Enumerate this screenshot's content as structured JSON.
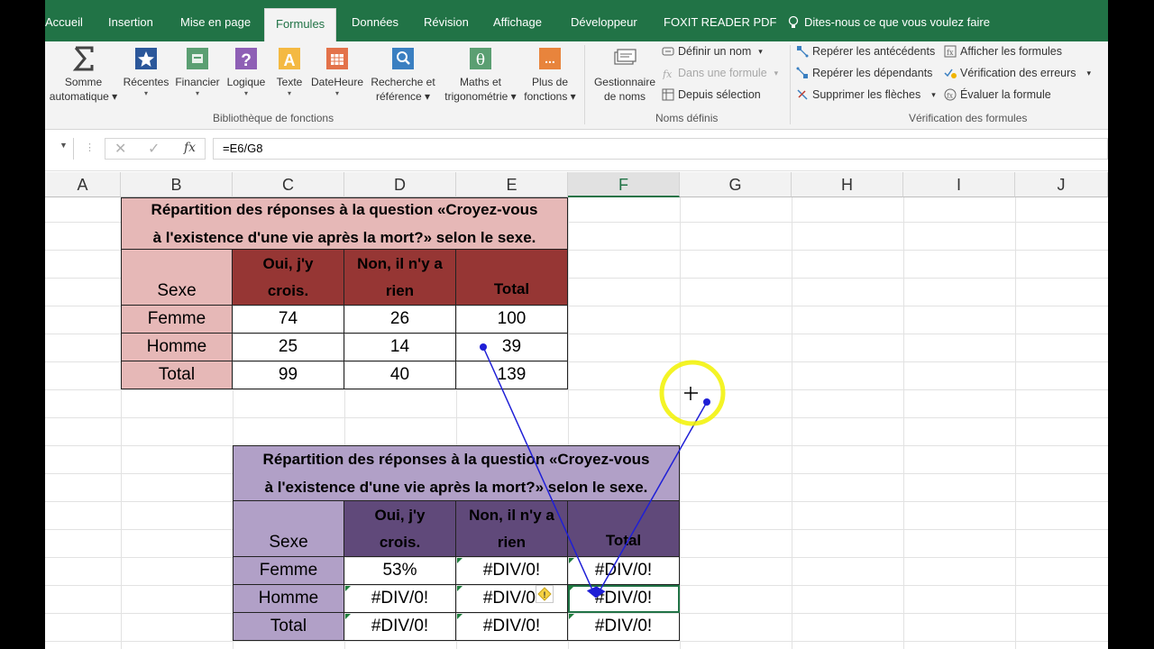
{
  "tabs": [
    "Accueil",
    "Insertion",
    "Mise en page",
    "Formules",
    "Données",
    "Révision",
    "Affichage",
    "Développeur",
    "FOXIT READER PDF"
  ],
  "active_tab": "Formules",
  "tell_me": "Dites-nous ce que vous voulez faire",
  "ribbon": {
    "somme": [
      "Somme",
      "automatique"
    ],
    "recentes": "Récentes",
    "financier": "Financier",
    "logique": "Logique",
    "texte": "Texte",
    "dateheure": "DateHeure",
    "recherche": [
      "Recherche et",
      "référence"
    ],
    "maths": [
      "Maths et",
      "trigonométrie"
    ],
    "plus": [
      "Plus de",
      "fonctions"
    ],
    "bibliotheque_label": "Bibliothèque de fonctions",
    "gestionnaire": [
      "Gestionnaire",
      "de noms"
    ],
    "definir": "Définir un nom",
    "dans_formule": "Dans une formule",
    "depuis": "Depuis sélection",
    "noms_label": "Noms définis",
    "antecedents": "Repérer les antécédents",
    "dependants": "Repérer les dépendants",
    "supprimer": "Supprimer les flèches",
    "afficher": "Afficher les formules",
    "verification": "Vérification des erreurs",
    "evaluer": "Évaluer la formule",
    "verif_label": "Vérification des formules"
  },
  "formula_bar": {
    "fx": "fx",
    "formula": "=E6/G8"
  },
  "columns": [
    "A",
    "B",
    "C",
    "D",
    "E",
    "F",
    "G",
    "H",
    "I",
    "J"
  ],
  "selected_column": "F",
  "table1": {
    "title1": "Répartition des réponses à la question «Croyez-vous",
    "title2": "à l'existence d'une vie après la mort?» selon le sexe.",
    "h_sexe": "Sexe",
    "h_oui": [
      "Oui, j'y",
      "crois."
    ],
    "h_non": [
      "Non, il n'y a",
      "rien"
    ],
    "h_total": "Total",
    "rows": [
      {
        "label": "Femme",
        "oui": "74",
        "non": "26",
        "total": "100"
      },
      {
        "label": "Homme",
        "oui": "25",
        "non": "14",
        "total": "39"
      },
      {
        "label": "Total",
        "oui": "99",
        "non": "40",
        "total": "139"
      }
    ]
  },
  "table2": {
    "title1": "Répartition des réponses à la question «Croyez-vous",
    "title2": "à l'existence d'une vie après la mort?» selon le sexe.",
    "h_sexe": "Sexe",
    "h_oui": [
      "Oui, j'y",
      "crois."
    ],
    "h_non": [
      "Non, il n'y a",
      "rien"
    ],
    "h_total": "Total",
    "rows": [
      {
        "label": "Femme",
        "oui": "53%",
        "non": "#DIV/0!",
        "total": "#DIV/0!"
      },
      {
        "label": "Homme",
        "oui": "#DIV/0!",
        "non": "#DIV/0!",
        "total": "#DIV/0!"
      },
      {
        "label": "Total",
        "oui": "#DIV/0!",
        "non": "#DIV/0!",
        "total": "#DIV/0!"
      }
    ]
  },
  "colors": {
    "excel_green": "#217346",
    "t1_title": "#e6b8b7",
    "t1_header": "#963634",
    "t1_label": "#e6b8b7",
    "t2_title": "#b1a0c7",
    "t2_header": "#60497a",
    "t2_label": "#b1a0c7",
    "trace_arrow": "#1f1fd6",
    "highlight": "#f2f200"
  }
}
